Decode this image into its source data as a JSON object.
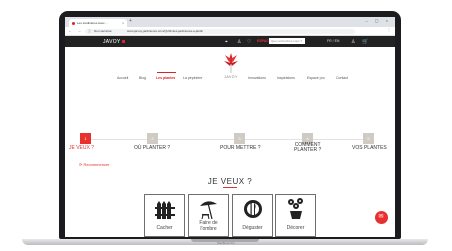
{
  "device": {
    "brand": "MacBook Pro"
  },
  "browser": {
    "tab_title": "Les Jardinières Avec ...",
    "tab_close": "×",
    "new_tab": "+",
    "window_controls": "– ▢ ×",
    "nav_arrows": "← → ⟳",
    "site_label": "Non sécurisé",
    "url": "www.jarvoy-jardinieres.com/QUIZ-des-jardinieres-a-jardin",
    "menu": "⋮"
  },
  "topbar": {
    "logo": "JAVOY",
    "pro_label": "ESPACE PRO",
    "search_placeholder": "Que recherchez-vous ?",
    "lang": "FR / EN",
    "icons": {
      "account": "account-icon",
      "cart": "cart-icon",
      "heart": "heart-icon",
      "location": "location-icon"
    }
  },
  "header": {
    "logo": "JAVOY"
  },
  "nav": {
    "items": [
      "Accueil",
      "Blog",
      "Les plantes",
      "La pépinière",
      "Innovations",
      "Inspirations",
      "Espace pro",
      "Contact"
    ],
    "active_index": 2
  },
  "steps": [
    {
      "num": "1",
      "label": "JE VEUX ?",
      "active": true
    },
    {
      "num": "2",
      "label": "OÙ PLANTER ?",
      "active": false
    },
    {
      "num": "3",
      "label": "POUR METTRE ?",
      "active": false
    },
    {
      "num": "4",
      "label": "COMMENT\nPLANTER ?",
      "active": false
    },
    {
      "num": "5",
      "label": "VOS PLANTES",
      "active": false
    }
  ],
  "restart_label": "⟳ Recommencer",
  "question": "JE VEUX ?",
  "options": [
    {
      "label": "Cacher",
      "icon": "fence-icon"
    },
    {
      "label": "Faire de\nl'ombre",
      "icon": "parasol-icon"
    },
    {
      "label": "Déguster",
      "icon": "plate-cutlery-icon"
    },
    {
      "label": "Décorer",
      "icon": "flowers-vase-icon"
    }
  ],
  "chat": {
    "icon": "chat-icon",
    "glyph": "✉"
  },
  "colors": {
    "accent": "#e8312f",
    "topbar": "#222222",
    "step_inactive": "#cfcac3"
  }
}
